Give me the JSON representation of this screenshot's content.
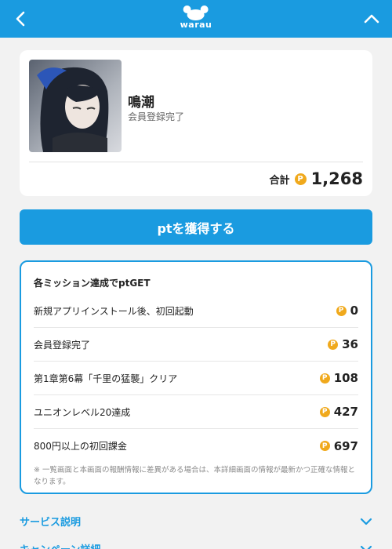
{
  "header": {
    "logo_text": "warau",
    "back_icon": "chevron-left-icon",
    "collapse_icon": "chevron-up-icon",
    "color": "#1a9be0"
  },
  "profile": {
    "name": "鳴潮",
    "status": "会員登録完了",
    "total_label": "合計",
    "total_value": "1,268",
    "coin_glyph": "P"
  },
  "cta": {
    "label": "ptを獲得する"
  },
  "missions": {
    "title": "各ミッション達成でptGET",
    "items": [
      {
        "label": "新規アプリインストール後、初回起動",
        "points": "0"
      },
      {
        "label": "会員登録完了",
        "points": "36"
      },
      {
        "label": "第1章第6幕「千里の猛襲」クリア",
        "points": "108"
      },
      {
        "label": "ユニオンレベル20達成",
        "points": "427"
      },
      {
        "label": "800円以上の初回課金",
        "points": "697"
      }
    ],
    "note": "※ 一覧画面と本画面の報酬情報に差異がある場合は、本詳細画面の情報が最新かつ正確な情報となります。"
  },
  "accordions": [
    {
      "label": "サービス説明"
    },
    {
      "label": "キャンペーン詳細"
    }
  ],
  "colors": {
    "accent": "#1a9be0",
    "coin": "#f0a91c"
  }
}
